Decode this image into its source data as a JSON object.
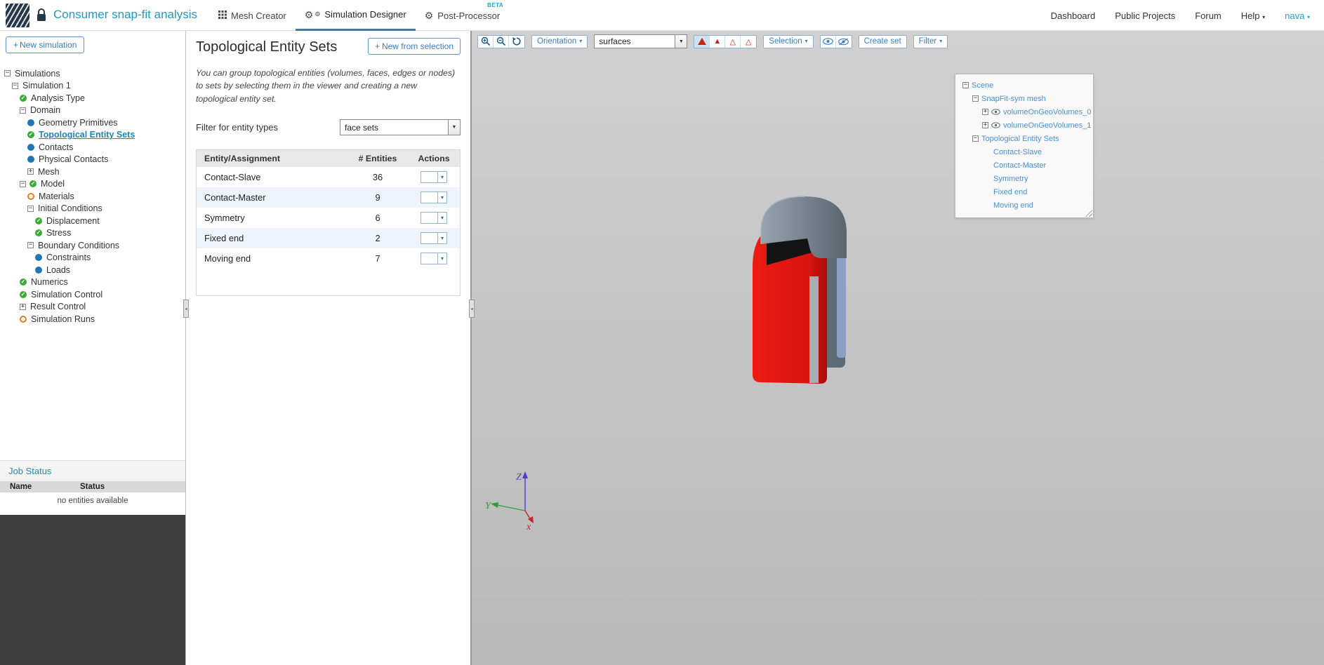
{
  "header": {
    "title": "Consumer snap-fit analysis",
    "tabs": [
      {
        "label": "Mesh Creator",
        "active": false
      },
      {
        "label": "Simulation Designer",
        "active": true
      },
      {
        "label": "Post-Processor",
        "active": false,
        "badge": "BETA"
      }
    ],
    "links": [
      "Dashboard",
      "Public Projects",
      "Forum"
    ],
    "help_label": "Help",
    "user_label": "nava"
  },
  "sidebar": {
    "new_simulation_label": "New simulation",
    "tree": [
      {
        "label": "Simulations",
        "depth": 0,
        "expander": "minus",
        "icon": null
      },
      {
        "label": "Simulation 1",
        "depth": 1,
        "expander": "minus",
        "icon": null
      },
      {
        "label": "Analysis Type",
        "depth": 2,
        "expander": null,
        "icon": "check"
      },
      {
        "label": "Domain",
        "depth": 2,
        "expander": "minus",
        "icon": null
      },
      {
        "label": "Geometry Primitives",
        "depth": 3,
        "expander": null,
        "icon": "dot"
      },
      {
        "label": "Topological Entity Sets",
        "depth": 3,
        "expander": null,
        "icon": "check",
        "selected": true
      },
      {
        "label": "Contacts",
        "depth": 3,
        "expander": null,
        "icon": "dot"
      },
      {
        "label": "Physical Contacts",
        "depth": 3,
        "expander": null,
        "icon": "dot"
      },
      {
        "label": "Mesh",
        "depth": 3,
        "expander": "plus",
        "icon": null
      },
      {
        "label": "Model",
        "depth": 2,
        "expander": "minus",
        "icon": "check"
      },
      {
        "label": "Materials",
        "depth": 3,
        "expander": null,
        "icon": "circle"
      },
      {
        "label": "Initial Conditions",
        "depth": 3,
        "expander": "minus",
        "icon": null
      },
      {
        "label": "Displacement",
        "depth": 4,
        "expander": null,
        "icon": "check"
      },
      {
        "label": "Stress",
        "depth": 4,
        "expander": null,
        "icon": "check"
      },
      {
        "label": "Boundary Conditions",
        "depth": 3,
        "expander": "minus",
        "icon": null
      },
      {
        "label": "Constraints",
        "depth": 4,
        "expander": null,
        "icon": "dot"
      },
      {
        "label": "Loads",
        "depth": 4,
        "expander": null,
        "icon": "dot"
      },
      {
        "label": "Numerics",
        "depth": 2,
        "expander": null,
        "icon": "check"
      },
      {
        "label": "Simulation Control",
        "depth": 2,
        "expander": null,
        "icon": "check"
      },
      {
        "label": "Result Control",
        "depth": 2,
        "expander": "plus",
        "icon": null
      },
      {
        "label": "Simulation Runs",
        "depth": 2,
        "expander": null,
        "icon": "circle"
      }
    ],
    "job_status": {
      "title": "Job Status",
      "columns": [
        "Name",
        "Status"
      ],
      "empty": "no entities available"
    }
  },
  "panel": {
    "title": "Topological Entity Sets",
    "new_from_selection_label": "New from selection",
    "description": "You can group topological entities (volumes, faces, edges or nodes) to sets by selecting them in the viewer and creating a new topological entity set.",
    "filter_label": "Filter for entity types",
    "filter_value": "face sets",
    "table": {
      "headers": [
        "Entity/Assignment",
        "# Entities",
        "Actions"
      ],
      "rows": [
        {
          "name": "Contact-Slave",
          "entities": "36"
        },
        {
          "name": "Contact-Master",
          "entities": "9"
        },
        {
          "name": "Symmetry",
          "entities": "6"
        },
        {
          "name": "Fixed end",
          "entities": "2"
        },
        {
          "name": "Moving end",
          "entities": "7"
        }
      ]
    }
  },
  "viewer": {
    "toolbar": {
      "orientation": "Orientation",
      "render_mode": "surfaces",
      "selection": "Selection",
      "create_set": "Create set",
      "filter": "Filter"
    },
    "scene_tree": [
      {
        "label": "Scene",
        "depth": 0,
        "expander": "minus",
        "eye": false
      },
      {
        "label": "SnapFit-sym mesh",
        "depth": 1,
        "expander": "minus",
        "eye": false
      },
      {
        "label": "volumeOnGeoVolumes_0",
        "depth": 2,
        "expander": "plus",
        "eye": true
      },
      {
        "label": "volumeOnGeoVolumes_1",
        "depth": 2,
        "expander": "plus",
        "eye": true
      },
      {
        "label": "Topological Entity Sets",
        "depth": 1,
        "expander": "minus",
        "eye": false
      },
      {
        "label": "Contact-Slave",
        "depth": 2,
        "expander": null,
        "eye": false
      },
      {
        "label": "Contact-Master",
        "depth": 2,
        "expander": null,
        "eye": false
      },
      {
        "label": "Symmetry",
        "depth": 2,
        "expander": null,
        "eye": false
      },
      {
        "label": "Fixed end",
        "depth": 2,
        "expander": null,
        "eye": false
      },
      {
        "label": "Moving end",
        "depth": 2,
        "expander": null,
        "eye": false
      }
    ],
    "axes": {
      "x": "x",
      "y": "Y",
      "z": "Z"
    }
  },
  "colors": {
    "accent_teal": "#2496c6",
    "link_blue": "#3a7cbf",
    "check_green": "#3aaa35",
    "dot_blue": "#2076b4",
    "warn_orange": "#e87a22",
    "model_red": "#d91410",
    "beta_teal": "#2aa3c9"
  }
}
